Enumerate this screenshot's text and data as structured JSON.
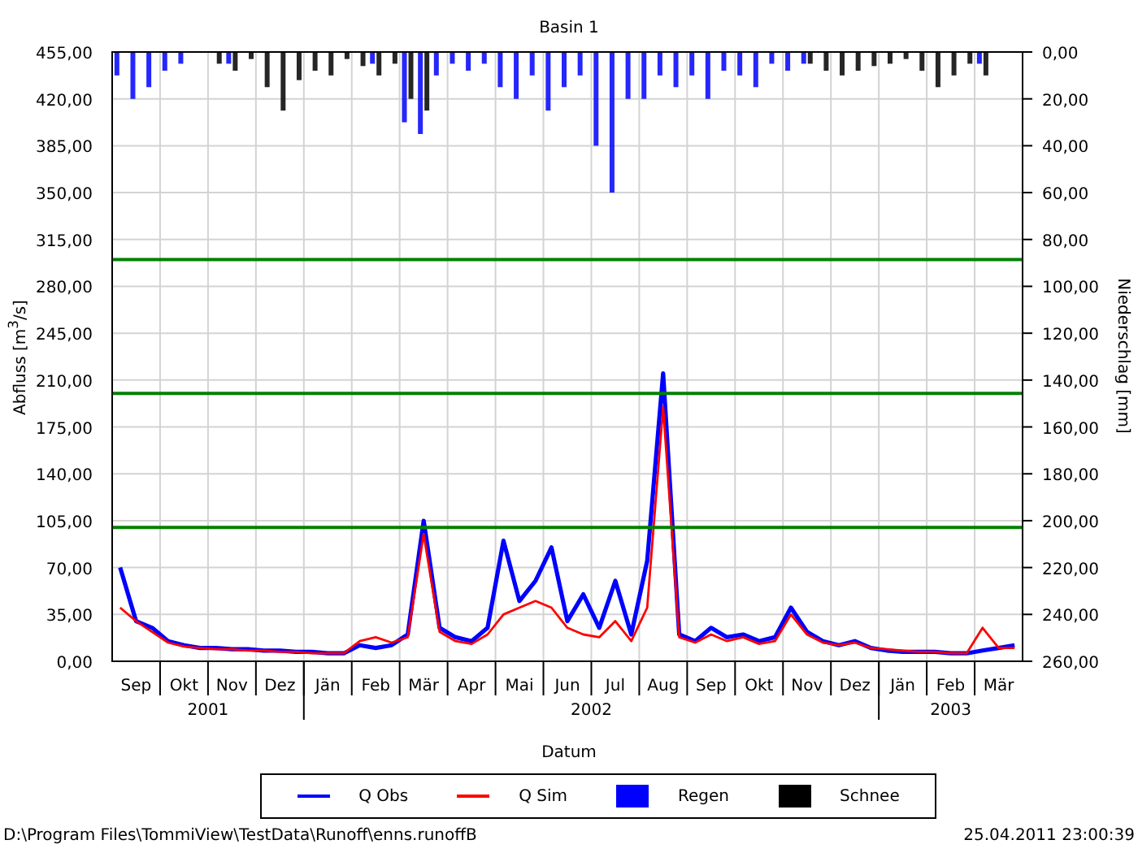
{
  "chart": {
    "title": "Basin 1",
    "y_label": "Abfluss [m$^{3}$/s]",
    "y2_label": "Niederschlag [mm]",
    "x_axis": [
      {
        "year": "2001",
        "months": [
          "Sep",
          "Okt",
          "Nov",
          "Dez"
        ]
      },
      {
        "year": "2002",
        "months": [
          "Jän",
          "Feb",
          "Mär",
          "Apr",
          "Mai",
          "Jun",
          "Jul",
          "Aug",
          "Sep",
          "Okt",
          "Nov",
          "Dez"
        ]
      },
      {
        "year": "2003",
        "months": [
          "Jän",
          "Feb",
          "Mär"
        ]
      }
    ],
    "chart_data": {
      "type": "line",
      "xlabel": "Datum",
      "grid": true,
      "categories": [
        null,
        null,
        null,
        null,
        null,
        null,
        null,
        null,
        null,
        null,
        null,
        null,
        null,
        null,
        null,
        null,
        null,
        null,
        null,
        null,
        null,
        null,
        null,
        null,
        null,
        null,
        null,
        null,
        null,
        null,
        null,
        null,
        null,
        null,
        null,
        null,
        null,
        null,
        null,
        null,
        null,
        null,
        null,
        null,
        null,
        null,
        null,
        null,
        null,
        null,
        null,
        null,
        null,
        null,
        null,
        null,
        null
      ],
      "ylim": [
        0,
        455
      ],
      "y2lim": [
        260,
        0
      ],
      "yticks": [
        {
          "value": 0,
          "label": "0,00"
        },
        {
          "value": 35,
          "label": "35,00"
        },
        {
          "value": 70,
          "label": "70,00"
        },
        {
          "value": 105,
          "label": "105,00"
        },
        {
          "value": 140,
          "label": "140,00"
        },
        {
          "value": 175,
          "label": "175,00"
        },
        {
          "value": 210,
          "label": "210,00"
        },
        {
          "value": 245,
          "label": "245,00"
        },
        {
          "value": 280,
          "label": "280,00"
        },
        {
          "value": 315,
          "label": "315,00"
        },
        {
          "value": 350,
          "label": "350,00"
        },
        {
          "value": 385,
          "label": "385,00"
        },
        {
          "value": 420,
          "label": "420,00"
        },
        {
          "value": 455,
          "label": "455,00"
        }
      ],
      "y2ticks": [
        {
          "value": 0,
          "label": "0,00"
        },
        {
          "value": 20,
          "label": "20,00"
        },
        {
          "value": 40,
          "label": "40,00"
        },
        {
          "value": 60,
          "label": "60,00"
        },
        {
          "value": 80,
          "label": "80,00"
        },
        {
          "value": 100,
          "label": "100,00"
        },
        {
          "value": 120,
          "label": "120,00"
        },
        {
          "value": 140,
          "label": "140,00"
        },
        {
          "value": 160,
          "label": "160,00"
        },
        {
          "value": 180,
          "label": "180,00"
        },
        {
          "value": 200,
          "label": "200,00"
        },
        {
          "value": 220,
          "label": "220,00"
        },
        {
          "value": 240,
          "label": "240,00"
        },
        {
          "value": 260,
          "label": "260,00"
        }
      ],
      "series": [
        {
          "name": "Q Obs",
          "color": "#0000ff",
          "values": [
            70,
            30,
            25,
            15,
            12,
            10,
            10,
            9,
            9,
            8,
            8,
            7,
            7,
            6,
            6,
            12,
            10,
            12,
            20,
            105,
            25,
            18,
            15,
            25,
            90,
            45,
            60,
            85,
            30,
            50,
            25,
            60,
            20,
            75,
            215,
            20,
            15,
            25,
            18,
            20,
            15,
            18,
            40,
            22,
            15,
            12,
            15,
            10,
            8,
            7,
            7,
            7,
            6,
            6,
            8,
            10,
            12
          ]
        },
        {
          "name": "Q Sim",
          "color": "#ff0000",
          "values": [
            40,
            30,
            22,
            14,
            11,
            10,
            9,
            9,
            8,
            8,
            7,
            7,
            6,
            6,
            6,
            15,
            18,
            14,
            18,
            95,
            22,
            15,
            13,
            20,
            35,
            40,
            45,
            40,
            25,
            20,
            18,
            30,
            15,
            40,
            190,
            18,
            14,
            20,
            15,
            18,
            13,
            15,
            35,
            20,
            14,
            12,
            14,
            10,
            9,
            8,
            7,
            7,
            6,
            6,
            25,
            10,
            10
          ]
        },
        {
          "name": "Regen",
          "color": "#0000ff",
          "type": "bar",
          "axis": "y2",
          "values": [
            10,
            20,
            15,
            8,
            5,
            0,
            0,
            5,
            0,
            0,
            0,
            0,
            0,
            0,
            0,
            0,
            5,
            0,
            30,
            35,
            10,
            5,
            8,
            5,
            15,
            20,
            10,
            25,
            15,
            10,
            40,
            60,
            20,
            20,
            10,
            15,
            10,
            20,
            8,
            10,
            15,
            5,
            8,
            5,
            0,
            0,
            0,
            0,
            0,
            0,
            0,
            0,
            0,
            0,
            5,
            0,
            0
          ]
        },
        {
          "name": "Schnee",
          "color": "#000000",
          "type": "bar",
          "axis": "y2",
          "values": [
            0,
            0,
            0,
            0,
            0,
            0,
            5,
            8,
            3,
            15,
            25,
            12,
            8,
            10,
            3,
            6,
            10,
            5,
            20,
            25,
            0,
            0,
            0,
            0,
            0,
            0,
            0,
            0,
            0,
            0,
            0,
            0,
            0,
            0,
            0,
            0,
            0,
            0,
            0,
            0,
            0,
            0,
            0,
            5,
            8,
            10,
            8,
            6,
            5,
            3,
            8,
            15,
            10,
            5,
            10,
            0,
            0
          ]
        }
      ],
      "ref_lines": [
        {
          "axis": "y",
          "value": 100,
          "color": "#008000"
        },
        {
          "axis": "y",
          "value": 200,
          "color": "#008000"
        },
        {
          "axis": "y",
          "value": 300,
          "color": "#008000"
        }
      ]
    }
  },
  "status": {
    "path": "D:\\Program Files\\TommiView\\TestData\\Runoff\\enns.runoffB",
    "timestamp": "25.04.2011 23:00:39"
  }
}
